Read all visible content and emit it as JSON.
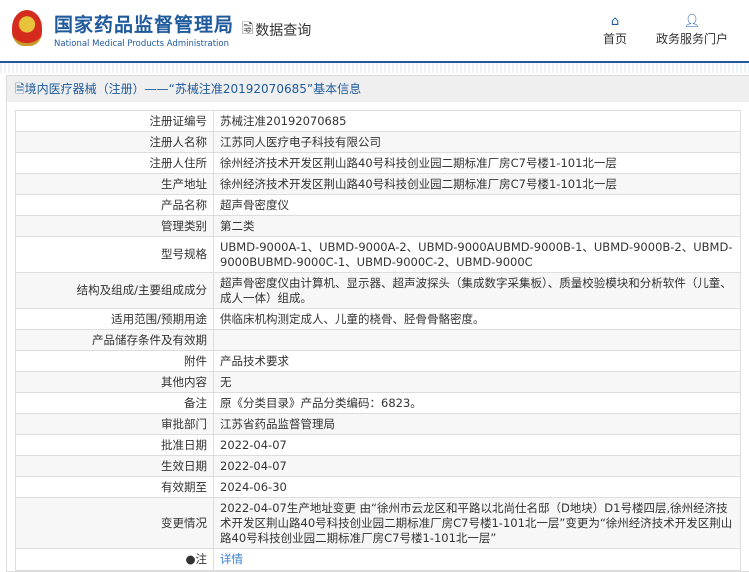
{
  "header": {
    "title_cn": "国家药品监督管理局",
    "title_en": "National Medical Products Administration",
    "section": "数据查询",
    "nav": [
      {
        "icon": "home-icon",
        "label": "首页"
      },
      {
        "icon": "user-icon",
        "label": "政务服务门户"
      }
    ]
  },
  "panel_title": "境内医疗器械（注册）——“苏械注准20192070685”基本信息",
  "rows": [
    {
      "label": "注册证编号",
      "value": "苏械注准20192070685"
    },
    {
      "label": "注册人名称",
      "value": "江苏同人医疗电子科技有限公司"
    },
    {
      "label": "注册人住所",
      "value": "徐州经济技术开发区荆山路40号科技创业园二期标准厂房C7号楼1-101北一层"
    },
    {
      "label": "生产地址",
      "value": "徐州经济技术开发区荆山路40号科技创业园二期标准厂房C7号楼1-101北一层"
    },
    {
      "label": "产品名称",
      "value": "超声骨密度仪"
    },
    {
      "label": "管理类别",
      "value": "第二类"
    },
    {
      "label": "型号规格",
      "value": "UBMD-9000A-1、UBMD-9000A-2、UBMD-9000AUBMD-9000B-1、UBMD-9000B-2、UBMD-9000BUBMD-9000C-1、UBMD-9000C-2、UBMD-9000C"
    },
    {
      "label": "结构及组成/主要组成成分",
      "value": "超声骨密度仪由计算机、显示器、超声波探头（集成数字采集板）、质量校验模块和分析软件（儿童、成人一体）组成。"
    },
    {
      "label": "适用范围/预期用途",
      "value": "供临床机构测定成人、儿童的桡骨、胫骨骨骼密度。"
    },
    {
      "label": "产品储存条件及有效期",
      "value": ""
    },
    {
      "label": "附件",
      "value": "产品技术要求"
    },
    {
      "label": "其他内容",
      "value": "无"
    },
    {
      "label": "备注",
      "value": "原《分类目录》产品分类编码：6823。"
    },
    {
      "label": "审批部门",
      "value": "江苏省药品监督管理局"
    },
    {
      "label": "批准日期",
      "value": "2022-04-07"
    },
    {
      "label": "生效日期",
      "value": "2022-04-07"
    },
    {
      "label": "有效期至",
      "value": "2024-06-30"
    },
    {
      "label": "变更情况",
      "value": "2022-04-07生产地址变更 由“徐州市云龙区和平路以北尚仕名邸（D地块）D1号楼四层,徐州经济技术开发区荆山路40号科技创业园二期标准厂房C7号楼1-101北一层”变更为“徐州经济技术开发区荆山路40号科技创业园二期标准厂房C7号楼1-101北一层”"
    }
  ],
  "note": {
    "label": "注",
    "link": "详情"
  }
}
